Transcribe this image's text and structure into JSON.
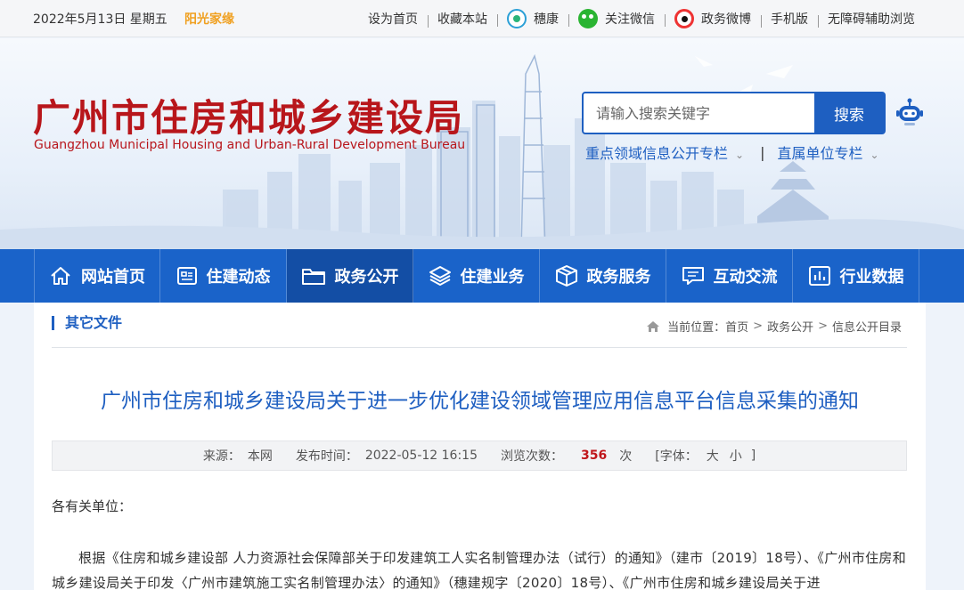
{
  "topbar": {
    "date": "2022年5月13日 星期五",
    "sunshine": "阳光家缘",
    "links": [
      {
        "label": "设为首页",
        "icon": ""
      },
      {
        "label": "收藏本站",
        "icon": ""
      },
      {
        "label": "穗康",
        "icon": "suikang-icon"
      },
      {
        "label": "关注微信",
        "icon": "wechat-icon"
      },
      {
        "label": "政务微博",
        "icon": "weibo-icon"
      },
      {
        "label": "手机版",
        "icon": ""
      },
      {
        "label": "无障碍辅助浏览",
        "icon": ""
      }
    ]
  },
  "header": {
    "logo_cn": "广州市住房和城乡建设局",
    "logo_en": "Guangzhou Municipal Housing and Urban-Rural Development Bureau",
    "search_placeholder": "请输入搜索关键字",
    "search_button": "搜索",
    "special_links": [
      "重点领域信息公开专栏",
      "直属单位专栏"
    ],
    "separator": "|"
  },
  "nav": {
    "items": [
      {
        "label": "网站首页",
        "icon": "home-icon"
      },
      {
        "label": "住建动态",
        "icon": "news-icon"
      },
      {
        "label": "政务公开",
        "icon": "folder-icon",
        "active": true
      },
      {
        "label": "住建业务",
        "icon": "layers-icon"
      },
      {
        "label": "政务服务",
        "icon": "box-icon"
      },
      {
        "label": "互动交流",
        "icon": "message-icon"
      },
      {
        "label": "行业数据",
        "icon": "chart-icon"
      }
    ]
  },
  "content": {
    "category": "其它文件",
    "breadcrumb": {
      "prefix": "当前位置：",
      "items": [
        "首页",
        "政务公开",
        "信息公开目录"
      ],
      "sep": ">"
    },
    "title": "广州市住房和城乡建设局关于进一步优化建设领域管理应用信息平台信息采集的通知",
    "meta": {
      "source_label": "来源：",
      "source": "本网",
      "time_label": "发布时间：",
      "time": "2022-05-12 16:15",
      "views_label": "浏览次数：",
      "views": "356",
      "views_unit": "次",
      "font_label": "[字体：",
      "font_large": "大",
      "font_small": "小",
      "font_end": "]"
    },
    "salutation": "各有关单位：",
    "paragraph": "根据《住房和城乡建设部 人力资源社会保障部关于印发建筑工人实名制管理办法（试行）的通知》（建市〔2019〕18号）、《广州市住房和城乡建设局关于印发〈广州市建筑施工实名制管理办法〉的通知》（穗建规字〔2020〕18号）、《广州市住房和城乡建设局关于进"
  },
  "colors": {
    "brand_red": "#b8161b",
    "primary_blue": "#1a63c9",
    "nav_active": "#134ea5",
    "views_red": "#c0161b"
  }
}
